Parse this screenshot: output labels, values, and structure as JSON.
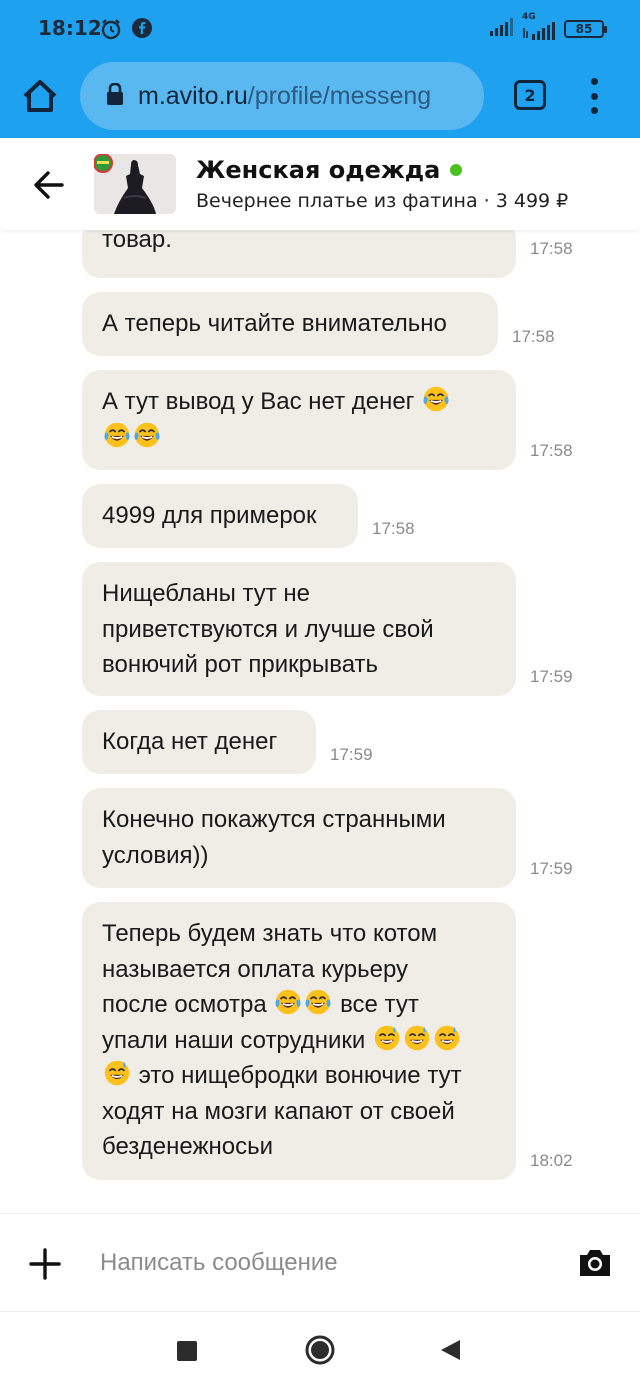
{
  "status_bar": {
    "time": "18:12",
    "network_label": "4G",
    "battery": "85"
  },
  "browser": {
    "url_host": "m.avito.ru",
    "url_path": "/profile/messeng",
    "tab_count": "2"
  },
  "chat_header": {
    "seller_name": "Женская одежда",
    "item_info": "Вечернее платье из фатина · 3 499 ₽",
    "online_color": "#49c11e"
  },
  "messages": [
    {
      "text": "товар.",
      "time": "17:58"
    },
    {
      "text": "А теперь читайте внимательно",
      "time": "17:58"
    },
    {
      "line1": "А тут вывод у Вас нет денег",
      "time": "17:58"
    },
    {
      "text": "4999 для примерок",
      "time": "17:58"
    },
    {
      "text": "Нищебланы тут не приветствуются и лучше свой вонючий рот прикрывать",
      "time": "17:59"
    },
    {
      "text": "Когда нет денег",
      "time": "17:59"
    },
    {
      "text": "Конечно покажутся странными условия))",
      "time": "17:59"
    },
    {
      "p1": "Теперь будем знать что котом называется оплата курьеру после осмотра",
      "p2": "все тут упали наши сотрудники",
      "p3": "это нищебродки вонючие тут ходят на мозги капают от своей безденежносьи",
      "time": "18:02"
    }
  ],
  "composer": {
    "placeholder": "Написать сообщение"
  },
  "icons": {
    "laugh_emoji": "face-with-tears-of-joy",
    "sweat_emoji": "grinning-face-with-sweat",
    "accent": "#1ea1ef",
    "bubble_color": "#f0ede7"
  }
}
